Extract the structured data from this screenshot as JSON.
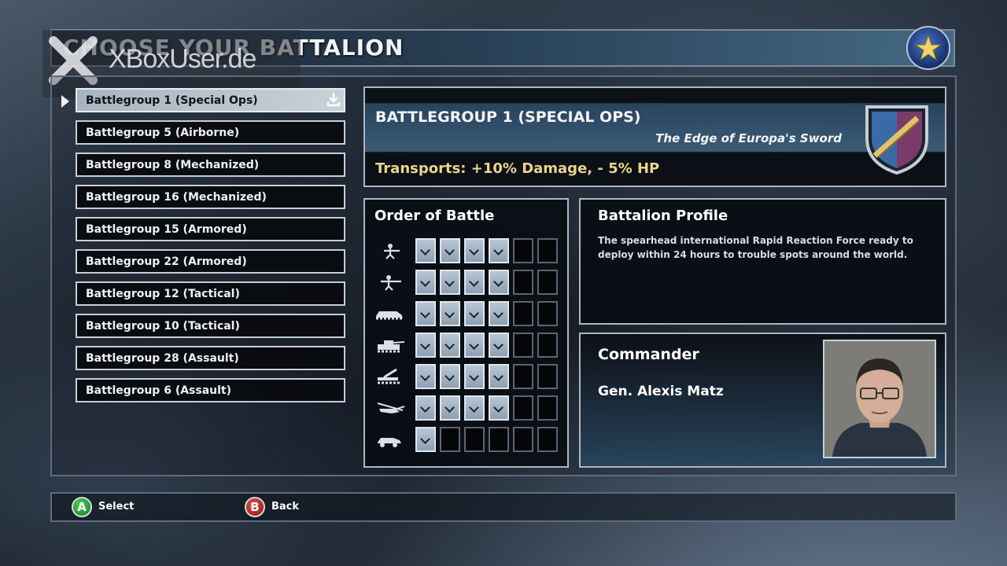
{
  "title": "CHOOSE YOUR BATTALION",
  "watermark": "XBoxUser.de",
  "battalions": [
    "Battlegroup 1 (Special Ops)",
    "Battlegroup 5 (Airborne)",
    "Battlegroup 8 (Mechanized)",
    "Battlegroup 16 (Mechanized)",
    "Battlegroup 15 (Armored)",
    "Battlegroup 22 (Armored)",
    "Battlegroup 12 (Tactical)",
    "Battlegroup 10 (Tactical)",
    "Battlegroup 28 (Assault)",
    "Battlegroup 6 (Assault)"
  ],
  "selected": {
    "name": "BATTLEGROUP 1 (SPECIAL OPS)",
    "motto": "The Edge of Europa's Sword",
    "bonus": "Transports: +10% Damage, - 5% HP"
  },
  "order_of_battle": {
    "title": "Order of Battle",
    "rows": [
      {
        "icon": "infantry-icon",
        "filled": 4,
        "total": 6
      },
      {
        "icon": "rifleman-icon",
        "filled": 4,
        "total": 6
      },
      {
        "icon": "apc-icon",
        "filled": 4,
        "total": 6
      },
      {
        "icon": "tank-icon",
        "filled": 4,
        "total": 6
      },
      {
        "icon": "artillery-icon",
        "filled": 4,
        "total": 6
      },
      {
        "icon": "helicopter-icon",
        "filled": 4,
        "total": 6
      },
      {
        "icon": "light-vehicle-icon",
        "filled": 1,
        "total": 6
      }
    ]
  },
  "profile": {
    "title": "Battalion Profile",
    "text": "The spearhead international Rapid Reaction Force ready to deploy within 24 hours to trouble spots around the world."
  },
  "commander": {
    "title": "Commander",
    "name": "Gen. Alexis Matz"
  },
  "controls": {
    "a_key": "A",
    "a_label": "Select",
    "b_key": "B",
    "b_label": "Back"
  },
  "colors": {
    "bonus": "#e8d58a",
    "button_a": "#2fa83a",
    "button_b": "#c02a2a"
  }
}
